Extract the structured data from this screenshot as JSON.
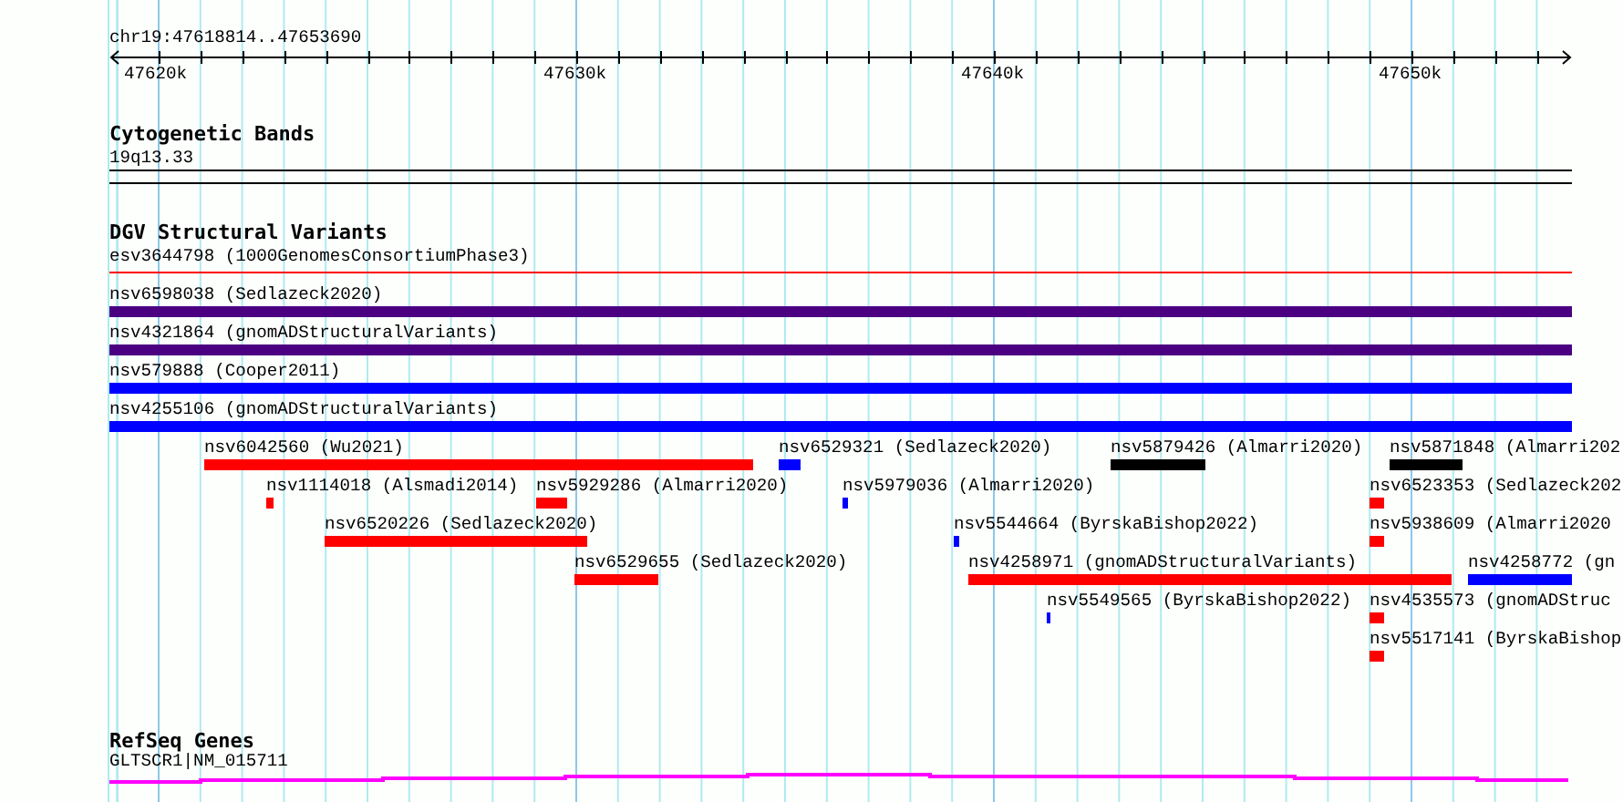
{
  "ruler": {
    "region": "chr19:47618814..47653690",
    "tick_labels": [
      "47620k",
      "47630k",
      "47640k",
      "47650k"
    ]
  },
  "cytogenetic_bands": {
    "title": "Cytogenetic Bands",
    "bands": [
      {
        "label": "19q13.33"
      }
    ]
  },
  "dgv_structural_variants": {
    "title": "DGV Structural Variants",
    "features": [
      {
        "label": "esv3644798 (1000GenomesConsortiumPhase3)",
        "kind": "line",
        "color": "#ff0000"
      },
      {
        "label": "nsv6598038 (Sedlazeck2020)",
        "kind": "bar",
        "color": "#4b0082"
      },
      {
        "label": "nsv4321864 (gnomADStructuralVariants)",
        "kind": "bar",
        "color": "#4b0082"
      },
      {
        "label": "nsv579888 (Cooper2011)",
        "kind": "bar",
        "color": "#0000ff"
      },
      {
        "label": "nsv4255106 (gnomADStructuralVariants)",
        "kind": "bar",
        "color": "#0000ff"
      },
      {
        "label": "nsv6042560 (Wu2021)",
        "kind": "bar",
        "color": "#ff0000"
      },
      {
        "label": "nsv6529321 (Sedlazeck2020)",
        "kind": "bar",
        "color": "#0000ff"
      },
      {
        "label": "nsv5879426 (Almarri2020)",
        "kind": "bar",
        "color": "#000000"
      },
      {
        "label": "nsv5871848 (Almarri202",
        "kind": "bar",
        "color": "#000000"
      },
      {
        "label": "nsv1114018 (Alsmadi2014)",
        "kind": "bar",
        "color": "#ff0000"
      },
      {
        "label": "nsv5929286 (Almarri2020)",
        "kind": "bar",
        "color": "#ff0000"
      },
      {
        "label": "nsv5979036 (Almarri2020)",
        "kind": "bar",
        "color": "#0000ff"
      },
      {
        "label": "nsv6523353 (Sedlazeck202",
        "kind": "bar",
        "color": "#ff0000"
      },
      {
        "label": "nsv6520226 (Sedlazeck2020)",
        "kind": "bar",
        "color": "#ff0000"
      },
      {
        "label": "nsv5544664 (ByrskaBishop2022)",
        "kind": "bar",
        "color": "#0000ff"
      },
      {
        "label": "nsv5938609 (Almarri2020",
        "kind": "bar",
        "color": "#ff0000"
      },
      {
        "label": "nsv6529655 (Sedlazeck2020)",
        "kind": "bar",
        "color": "#ff0000"
      },
      {
        "label": "nsv4258971 (gnomADStructuralVariants)",
        "kind": "bar",
        "color": "#ff0000"
      },
      {
        "label": "nsv4258772 (gn",
        "kind": "bar",
        "color": "#0000ff"
      },
      {
        "label": "nsv5549565 (ByrskaBishop2022)",
        "kind": "bar",
        "color": "#0000ff"
      },
      {
        "label": "nsv4535573 (gnomADStruc",
        "kind": "bar",
        "color": "#ff0000"
      },
      {
        "label": "nsv5517141 (ByrskaBishop",
        "kind": "bar",
        "color": "#ff0000"
      }
    ]
  },
  "refseq_genes": {
    "title": "RefSeq Genes",
    "genes": [
      {
        "label": "GLTSCR1|NM_015711",
        "color": "#ff00ff"
      }
    ]
  }
}
